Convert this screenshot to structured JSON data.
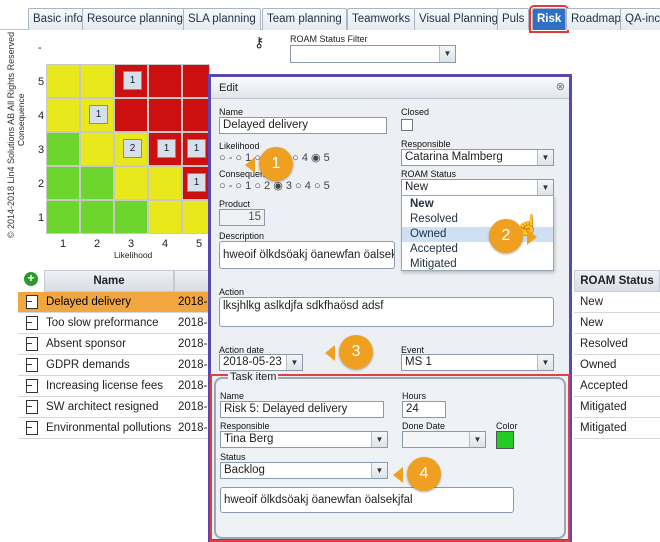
{
  "tabs": [
    "Basic info",
    "Resource planning",
    "SLA planning",
    "Team planning",
    "Teamworks",
    "Visual Planning",
    "Puls",
    "Risk",
    "Roadmap",
    "QA-inc"
  ],
  "active_tab": "Risk",
  "copyright": "© 2014-2018 Lin4 Solutions AB All Rights Reserved",
  "matrix": {
    "y_axis_label": "Consequence",
    "x_axis_label": "Likelihood",
    "row_labels": [
      "-",
      "5",
      "4",
      "3",
      "2",
      "1"
    ],
    "col_labels": [
      "1",
      "2",
      "3",
      "4",
      "5"
    ],
    "badges": [
      "1",
      "1",
      "2",
      "1",
      "1",
      "1"
    ]
  },
  "roam_filter": {
    "label": "ROAM Status Filter",
    "value": ""
  },
  "table": {
    "headers": [
      "Name",
      "ROAM Status"
    ],
    "rows": [
      {
        "name": "Delayed delivery",
        "date": "2018-",
        "status": "New",
        "selected": true
      },
      {
        "name": "Too slow preformance",
        "date": "2018-",
        "status": "New"
      },
      {
        "name": "Absent sponsor",
        "date": "2018-",
        "status": "Resolved"
      },
      {
        "name": "GDPR demands",
        "date": "2018-",
        "status": "Owned"
      },
      {
        "name": "Increasing license fees",
        "date": "2018-",
        "status": "Accepted"
      },
      {
        "name": "SW architect resigned",
        "date": "2018-",
        "status": "Mitigated"
      },
      {
        "name": "Environmental pollutions",
        "date": "2018-",
        "status": "Mitigated"
      }
    ]
  },
  "dialog": {
    "title": "Edit",
    "name_label": "Name",
    "name_value": "Delayed delivery",
    "closed_label": "Closed",
    "likelihood_label": "Likelihood",
    "likelihood_options": [
      "-",
      "1",
      "2",
      "3",
      "4",
      "5"
    ],
    "consequence_label": "Consequence",
    "consequence_options": [
      "-",
      "1",
      "2",
      "3",
      "4",
      "5"
    ],
    "responsible_label": "Responsible",
    "responsible_value": "Catarina Malmberg",
    "roam_label": "ROAM Status",
    "roam_value": "New",
    "roam_options": [
      "New",
      "Resolved",
      "Owned",
      "Accepted",
      "Mitigated"
    ],
    "product_label": "Product",
    "product_value": "15",
    "description_label": "Description",
    "description_value": "hweoif ölkdsöakj öanewfan öalsekjfal",
    "action_label": "Action",
    "action_value": "lksjhlkg aslkdjfa  sdkfhaösd adsf",
    "action_date_label": "Action date",
    "action_date_value": "2018-05-23",
    "event_label": "Event",
    "event_value": "MS 1",
    "task": {
      "legend": "Task item",
      "name_label": "Name",
      "name_value": "Risk 5: Delayed delivery",
      "hours_label": "Hours",
      "hours_value": "24",
      "responsible_label": "Responsible",
      "responsible_value": "Tina Berg",
      "done_date_label": "Done Date",
      "done_date_value": "",
      "color_label": "Color",
      "color_value": "#22cc22",
      "status_label": "Status",
      "status_value": "Backlog",
      "notes_value": "hweoif ölkdsöakj öanewfan öalsekjfal"
    }
  },
  "callouts": [
    "1",
    "2",
    "3",
    "4"
  ],
  "colors": {
    "accent": "#2f6fc4",
    "callout": "#f0a020",
    "highlight": "#e04040",
    "selected_row": "#f2a640"
  }
}
